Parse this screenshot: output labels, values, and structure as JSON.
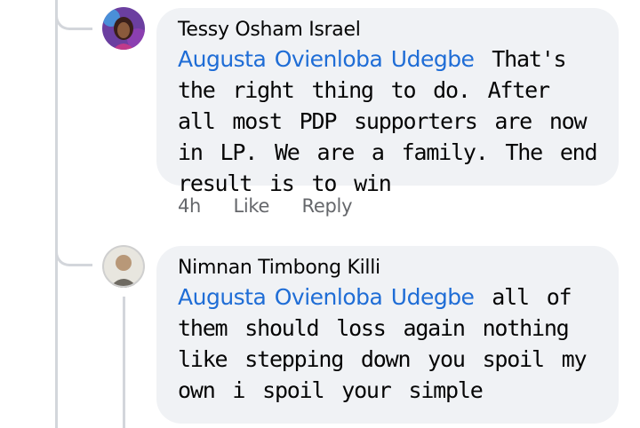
{
  "comments": [
    {
      "author": "Tessy Osham Israel",
      "mention": "Augusta Ovienloba Udegbe",
      "text": " That's the right thing to do. After all most PDP supporters are now in LP. We are a family. The end result is to win",
      "time": "4h",
      "like_label": "Like",
      "reply_label": "Reply"
    },
    {
      "author": "Nimnan Timbong Killi",
      "mention": "Augusta Ovienloba Udegbe",
      "text": " all of them should loss again nothing like stepping down you spoil my own i spoil your simple"
    }
  ]
}
